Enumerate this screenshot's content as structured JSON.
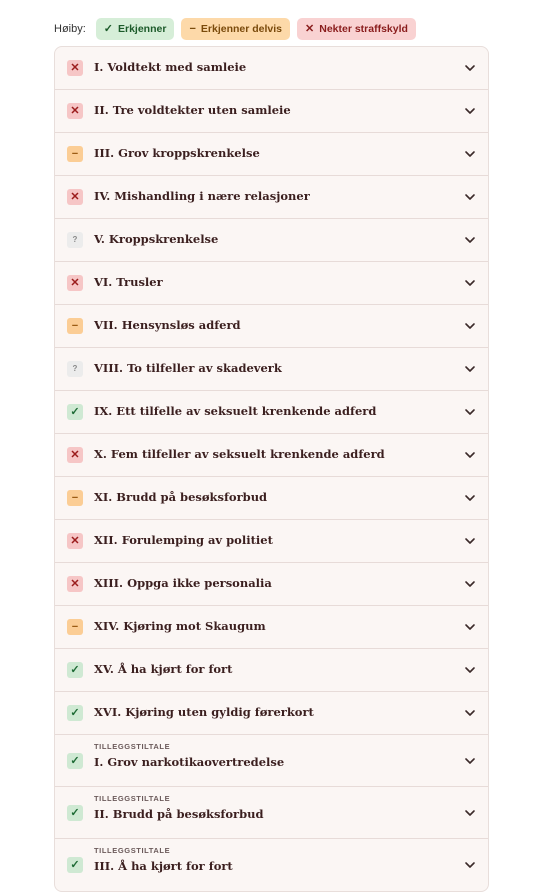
{
  "legend": {
    "title": "Høiby:",
    "items": [
      {
        "label": "Erkjenner",
        "icon": "✓",
        "tone": "green"
      },
      {
        "label": "Erkjenner delvis",
        "icon": "−",
        "tone": "orange"
      },
      {
        "label": "Nekter straffskyld",
        "icon": "✕",
        "tone": "red"
      }
    ]
  },
  "charges": [
    {
      "title": "I. Voldtekt med samleie",
      "status": "red",
      "icon": "✕"
    },
    {
      "title": "II. Tre voldtekter uten samleie",
      "status": "red",
      "icon": "✕"
    },
    {
      "title": "III. Grov kroppskrenkelse",
      "status": "orange",
      "icon": "−"
    },
    {
      "title": "IV. Mishandling i nære relasjoner",
      "status": "red",
      "icon": "✕"
    },
    {
      "title": "V. Kroppskrenkelse",
      "status": "grey",
      "icon": "?"
    },
    {
      "title": "VI. Trusler",
      "status": "red",
      "icon": "✕"
    },
    {
      "title": "VII. Hensynsløs adferd",
      "status": "orange",
      "icon": "−"
    },
    {
      "title": "VIII. To tilfeller av skadeverk",
      "status": "grey",
      "icon": "?"
    },
    {
      "title": "IX. Ett tilfelle av seksuelt krenkende adferd",
      "status": "green",
      "icon": "✓"
    },
    {
      "title": "X. Fem tilfeller av seksuelt krenkende adferd",
      "status": "red",
      "icon": "✕"
    },
    {
      "title": "XI. Brudd på besøksforbud",
      "status": "orange",
      "icon": "−"
    },
    {
      "title": "XII. Forulemping av politiet",
      "status": "red",
      "icon": "✕"
    },
    {
      "title": "XIII. Oppga ikke personalia",
      "status": "red",
      "icon": "✕"
    },
    {
      "title": "XIV. Kjøring mot Skaugum",
      "status": "orange",
      "icon": "−"
    },
    {
      "title": "XV. Å ha kjørt for fort",
      "status": "green",
      "icon": "✓"
    },
    {
      "title": "XVI. Kjøring uten gyldig førerkort",
      "status": "green",
      "icon": "✓"
    },
    {
      "kicker": "TILLEGGSTILTALE",
      "title": "I. Grov narkotikaovertredelse",
      "status": "green",
      "icon": "✓"
    },
    {
      "kicker": "TILLEGGSTILTALE",
      "title": "II. Brudd på besøksforbud",
      "status": "green",
      "icon": "✓"
    },
    {
      "kicker": "TILLEGGSTILTALE",
      "title": "III. Å ha kjørt for fort",
      "status": "green",
      "icon": "✓"
    }
  ]
}
